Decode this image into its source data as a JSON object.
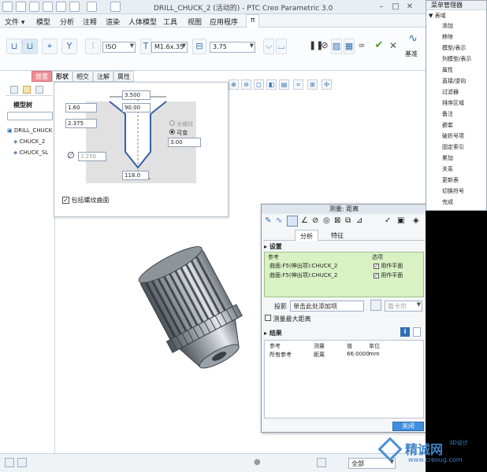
{
  "titlebar": {
    "title": "DRILL_CHUCK_2 (活动的) - PTC Creo Parametric 3.0",
    "minimize": "–",
    "maximize": "□",
    "close": "✕"
  },
  "menubar": {
    "tabs": [
      "文件 ▾",
      "模型",
      "分析",
      "注释",
      "渲染",
      "人体模型",
      "工具",
      "视图",
      "应用程序",
      "π"
    ]
  },
  "ribbon": {
    "standard": "ISO",
    "size": "M1.6x.35",
    "depth": "3.75",
    "datum_label": "基准"
  },
  "subtabs": [
    "放置",
    "形状",
    "相交",
    "注解",
    "属性"
  ],
  "left_panel": {
    "tab_label": "模型树",
    "items": [
      "DRILL_CHUCK",
      "CHUCK_2",
      "CHUCK_SL"
    ]
  },
  "shape_panel": {
    "dims": {
      "top": "3.500",
      "d1": "1.60",
      "angle": "90.00",
      "d2": "2.375",
      "d3": "3.00",
      "dia": "1.250",
      "tip": "118.0"
    },
    "radio_full": "全螺纹",
    "radio_variable": "可变",
    "checkbox_label": "包括螺纹曲面"
  },
  "measure_dialog": {
    "title": "测量: 距离",
    "tab_analysis": "分析",
    "tab_feature": "特征",
    "section_settings": "设置",
    "col_ref": "参考",
    "col_option": "选项",
    "refs": [
      {
        "name": "曲面:F5(伸出项):CHUCK_2",
        "option": "用作平面"
      },
      {
        "name": "曲面:F5(伸出项):CHUCK_2",
        "option": "用作平面"
      }
    ],
    "projection_label": "投影",
    "projection_value": "单击此处添加项",
    "projection_right": "笛卡尔",
    "max_distance_label": "测量最大距离",
    "section_results": "结果",
    "res_cols": [
      "参考",
      "测量",
      "值",
      "单位"
    ],
    "res_row": [
      "所有参考",
      "距离",
      "66.0000",
      "mm"
    ],
    "close_button": "关闭"
  },
  "menu_manager": {
    "title": "菜单管理器",
    "header": "▼ 表域",
    "items": [
      "添加",
      "移除",
      "模型/表示",
      "列模型/表示",
      "属性",
      "直接/逆向",
      "过滤器",
      "排序区域",
      "备注",
      "嵌套",
      "破折号项",
      "固定索引",
      "累加",
      "关系",
      "更新表",
      "切换符号",
      "完成"
    ]
  },
  "status": {
    "filter": "全部"
  },
  "watermark": {
    "brand": "精诚网",
    "sub": "3D设计",
    "url": "www.creoug.com"
  },
  "colors": {
    "accent": "#2f6fb0",
    "hot_tab": "#f28c96",
    "settings_bg": "#d9f2c4",
    "close_button": "#3e8ee0"
  }
}
